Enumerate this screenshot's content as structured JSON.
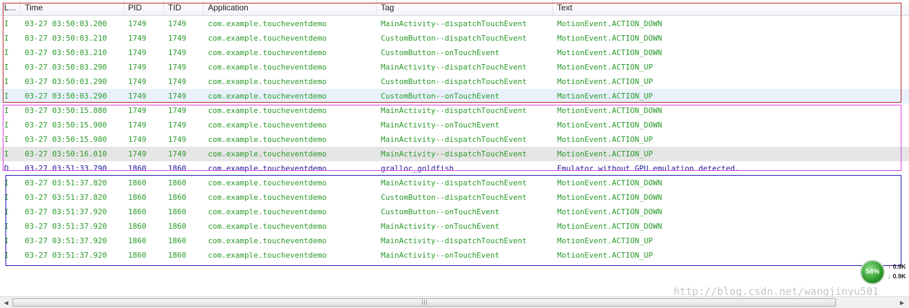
{
  "header": {
    "columns": [
      {
        "label": "L..."
      },
      {
        "label": "Time"
      },
      {
        "label": "PID"
      },
      {
        "label": "TID"
      },
      {
        "label": "Application"
      },
      {
        "label": "Tag"
      },
      {
        "label": "Text"
      }
    ]
  },
  "colors": {
    "info": "#2a9a2a",
    "debug": "#1a1a9c",
    "box_red": "#c0252a",
    "box_magenta": "#e13ee0",
    "box_blue": "#1a1ab4"
  },
  "rows": [
    {
      "level": "I",
      "time": "03-27 03:50:03.200",
      "pid": "1749",
      "tid": "1749",
      "app": "com.example.toucheventdemo",
      "tag": "MainActivity--dispatchTouchEvent",
      "text": "MotionEvent.ACTION_DOWN"
    },
    {
      "level": "I",
      "time": "03-27 03:50:03.210",
      "pid": "1749",
      "tid": "1749",
      "app": "com.example.toucheventdemo",
      "tag": "CustomButton--dispatchTouchEvent",
      "text": "MotionEvent.ACTION_DOWN"
    },
    {
      "level": "I",
      "time": "03-27 03:50:03.210",
      "pid": "1749",
      "tid": "1749",
      "app": "com.example.toucheventdemo",
      "tag": "CustomButton--onTouchEvent",
      "text": "MotionEvent.ACTION_DOWN"
    },
    {
      "level": "I",
      "time": "03-27 03:50:03.290",
      "pid": "1749",
      "tid": "1749",
      "app": "com.example.toucheventdemo",
      "tag": "MainActivity--dispatchTouchEvent",
      "text": "MotionEvent.ACTION_UP"
    },
    {
      "level": "I",
      "time": "03-27 03:50:03.290",
      "pid": "1749",
      "tid": "1749",
      "app": "com.example.toucheventdemo",
      "tag": "CustomButton--dispatchTouchEvent",
      "text": "MotionEvent.ACTION_UP"
    },
    {
      "level": "I",
      "time": "03-27 03:50:03.290",
      "pid": "1749",
      "tid": "1749",
      "app": "com.example.toucheventdemo",
      "tag": "CustomButton--onTouchEvent",
      "text": "MotionEvent.ACTION_UP"
    },
    {
      "level": "I",
      "time": "03-27 03:50:15.880",
      "pid": "1749",
      "tid": "1749",
      "app": "com.example.toucheventdemo",
      "tag": "MainActivity--dispatchTouchEvent",
      "text": "MotionEvent.ACTION_DOWN"
    },
    {
      "level": "I",
      "time": "03-27 03:50:15.900",
      "pid": "1749",
      "tid": "1749",
      "app": "com.example.toucheventdemo",
      "tag": "MainActivity--onTouchEvent",
      "text": "MotionEvent.ACTION_DOWN"
    },
    {
      "level": "I",
      "time": "03-27 03:50:15.980",
      "pid": "1749",
      "tid": "1749",
      "app": "com.example.toucheventdemo",
      "tag": "MainActivity--dispatchTouchEvent",
      "text": "MotionEvent.ACTION_UP"
    },
    {
      "level": "I",
      "time": "03-27 03:50:16.010",
      "pid": "1749",
      "tid": "1749",
      "app": "com.example.toucheventdemo",
      "tag": "MainActivity--dispatchTouchEvent",
      "text": "MotionEvent.ACTION_UP"
    },
    {
      "level": "D",
      "time": "03-27 03:51:33.790",
      "pid": "1860",
      "tid": "1860",
      "app": "com.example.toucheventdemo",
      "tag": "gralloc_goldfish",
      "text": "Emulator without GPU emulation detected."
    },
    {
      "level": "I",
      "time": "03-27 03:51:37.820",
      "pid": "1860",
      "tid": "1860",
      "app": "com.example.toucheventdemo",
      "tag": "MainActivity--dispatchTouchEvent",
      "text": "MotionEvent.ACTION_DOWN"
    },
    {
      "level": "I",
      "time": "03-27 03:51:37.820",
      "pid": "1860",
      "tid": "1860",
      "app": "com.example.toucheventdemo",
      "tag": "CustomButton--dispatchTouchEvent",
      "text": "MotionEvent.ACTION_DOWN"
    },
    {
      "level": "I",
      "time": "03-27 03:51:37.920",
      "pid": "1860",
      "tid": "1860",
      "app": "com.example.toucheventdemo",
      "tag": "CustomButton--onTouchEvent",
      "text": "MotionEvent.ACTION_DOWN"
    },
    {
      "level": "I",
      "time": "03-27 03:51:37.920",
      "pid": "1860",
      "tid": "1860",
      "app": "com.example.toucheventdemo",
      "tag": "MainActivity--onTouchEvent",
      "text": "MotionEvent.ACTION_DOWN"
    },
    {
      "level": "I",
      "time": "03-27 03:51:37.920",
      "pid": "1860",
      "tid": "1860",
      "app": "com.example.toucheventdemo",
      "tag": "MainActivity--dispatchTouchEvent",
      "text": "MotionEvent.ACTION_UP"
    },
    {
      "level": "I",
      "time": "03-27 03:51:37.920",
      "pid": "1860",
      "tid": "1860",
      "app": "com.example.toucheventdemo",
      "tag": "MainActivity--onTouchEvent",
      "text": "MotionEvent.ACTION_UP"
    }
  ],
  "cpu_widget": {
    "percent": "54%",
    "up_value": "0.9K",
    "down_value": "0.9K",
    "up_icon": "arrow-up-icon",
    "down_icon": "arrow-down-icon"
  },
  "watermark": "http://blog.csdn.net/wangjinyu501",
  "scrollbar": {
    "grip_icon": "grip-icon",
    "left_icon": "scroll-left-icon",
    "right_icon": "scroll-right-icon"
  }
}
